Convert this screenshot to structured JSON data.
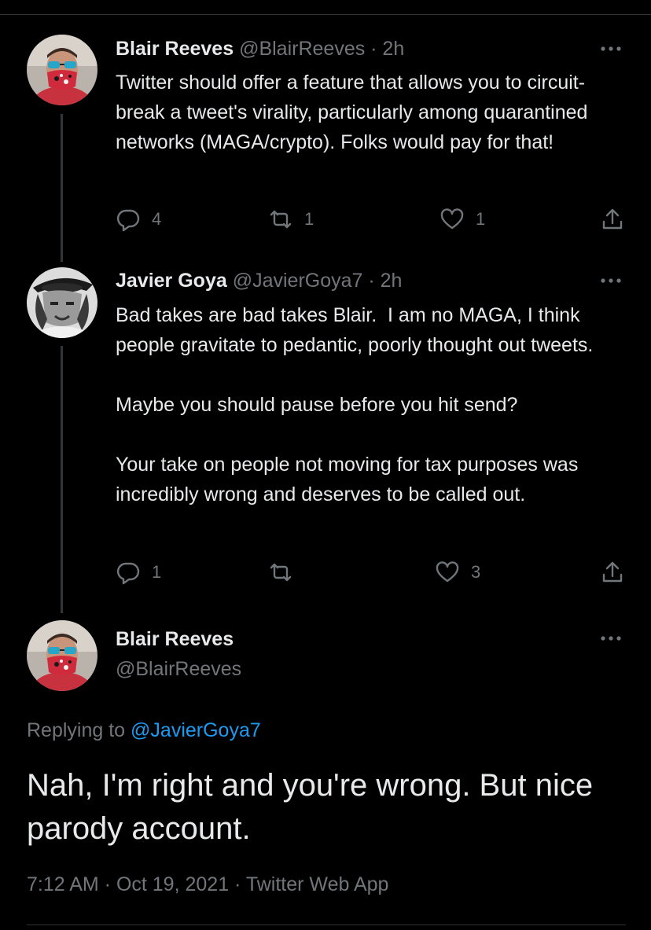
{
  "colors": {
    "background": "#000000",
    "text": "#e7e9ea",
    "secondary": "#71767b",
    "link": "#1d9bf0",
    "divider": "#2f3336"
  },
  "tweets": [
    {
      "name": "Blair Reeves",
      "handle_time": "@BlairReeves · 2h",
      "text": "Twitter should offer a feature that allows you to circuit-break a tweet's virality, particularly among quarantined networks (MAGA/crypto). Folks would pay for that!",
      "replies": "4",
      "retweets": "1",
      "likes": "1",
      "avatar": "avatar-sunglasses-mask"
    },
    {
      "name": "Javier Goya",
      "handle_time": "@JavierGoya7 · 2h",
      "text": "Bad takes are bad takes Blair.  I am no MAGA, I think people gravitate to pedantic, poorly thought out tweets.\n\nMaybe you should pause before you hit send?\n\nYour take on people not moving for tax purposes was incredibly wrong and deserves to be called out.",
      "replies": "1",
      "retweets": "",
      "likes": "3",
      "avatar": "avatar-black-white-portrait"
    }
  ],
  "main": {
    "name": "Blair Reeves",
    "handle": "@BlairReeves",
    "replying_prefix": "Replying to ",
    "replying_handle": "@JavierGoya7",
    "text": "Nah, I'm right and you're wrong. But nice parody account.",
    "meta": "7:12 AM · Oct 19, 2021 · Twitter Web App"
  },
  "icons": [
    "more-icon",
    "reply-icon",
    "retweet-icon",
    "like-icon",
    "share-icon"
  ]
}
